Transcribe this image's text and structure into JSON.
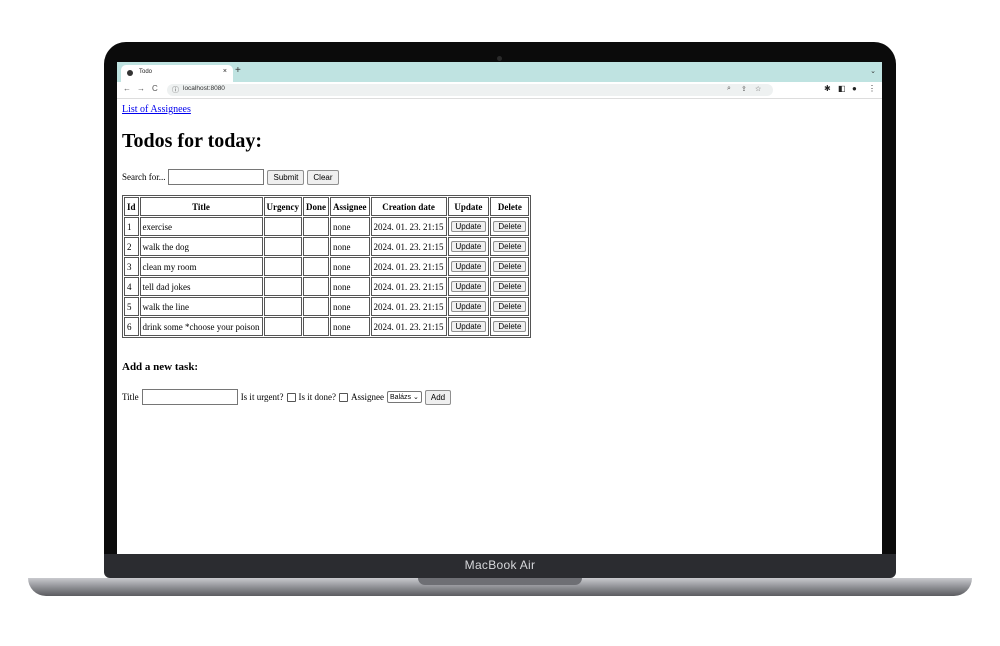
{
  "device": {
    "brand": "MacBook Air"
  },
  "browser": {
    "tab_title": "Todo",
    "tab_close": "×",
    "new_tab": "+",
    "tab_menu": "⌄",
    "url": "localhost:8080"
  },
  "page": {
    "assignees_link": "List of Assignees",
    "heading": "Todos for today:",
    "search": {
      "label": "Search for...",
      "value": "",
      "submit": "Submit",
      "clear": "Clear"
    },
    "table": {
      "headers": [
        "Id",
        "Title",
        "Urgency",
        "Done",
        "Assignee",
        "Creation date",
        "Update",
        "Delete"
      ],
      "update_label": "Update",
      "delete_label": "Delete",
      "rows": [
        {
          "id": "1",
          "title": "exercise",
          "urgency": "",
          "done": "",
          "assignee": "none",
          "date": "2024. 01. 23. 21:15"
        },
        {
          "id": "2",
          "title": "walk the dog",
          "urgency": "",
          "done": "",
          "assignee": "none",
          "date": "2024. 01. 23. 21:15"
        },
        {
          "id": "3",
          "title": "clean my room",
          "urgency": "",
          "done": "",
          "assignee": "none",
          "date": "2024. 01. 23. 21:15"
        },
        {
          "id": "4",
          "title": "tell dad jokes",
          "urgency": "",
          "done": "",
          "assignee": "none",
          "date": "2024. 01. 23. 21:15"
        },
        {
          "id": "5",
          "title": "walk the line",
          "urgency": "",
          "done": "",
          "assignee": "none",
          "date": "2024. 01. 23. 21:15"
        },
        {
          "id": "6",
          "title": "drink some *choose your poison",
          "urgency": "",
          "done": "",
          "assignee": "none",
          "date": "2024. 01. 23. 21:15"
        }
      ]
    },
    "add": {
      "heading": "Add a new task:",
      "title_label": "Title",
      "urgent_label": "Is it urgent?",
      "done_label": "Is it done?",
      "assignee_label": "Assignee",
      "assignee_selected": "Balázs",
      "add_button": "Add"
    }
  }
}
